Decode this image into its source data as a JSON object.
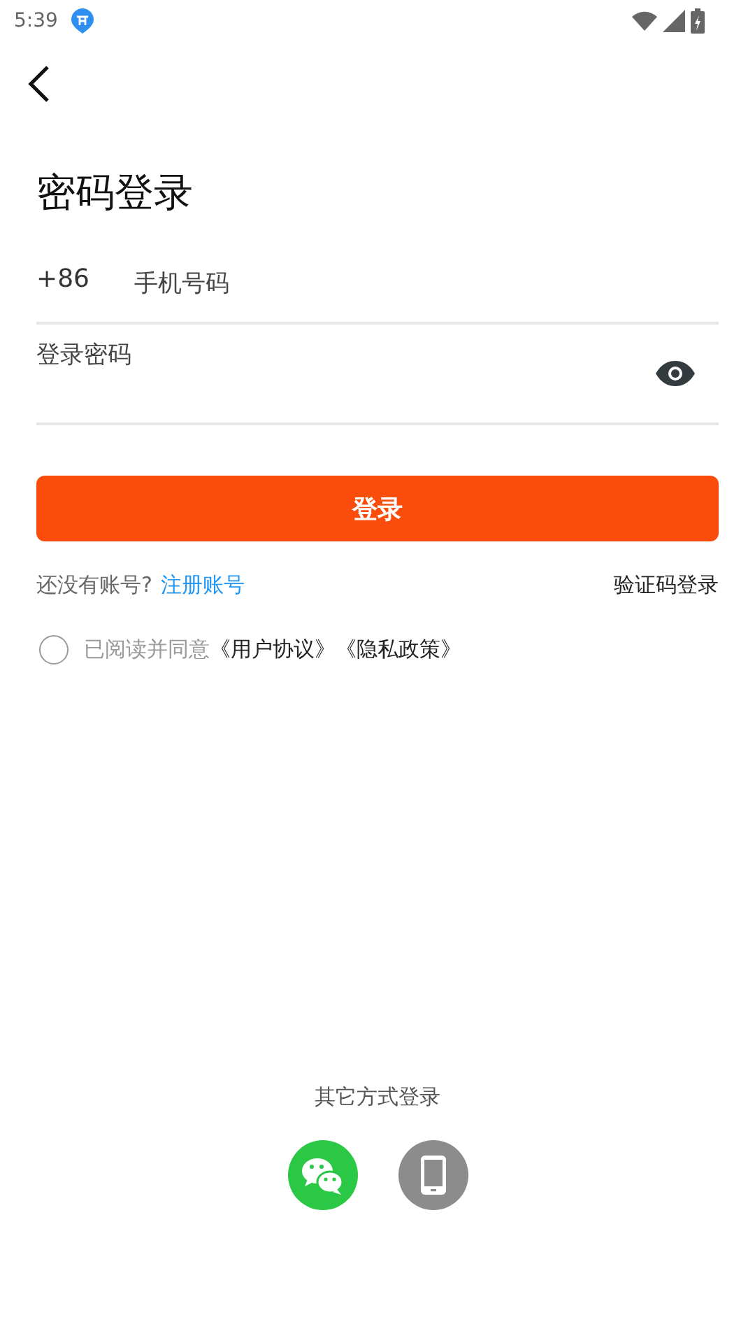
{
  "status_bar": {
    "time": "5:39"
  },
  "title": "密码登录",
  "phone": {
    "prefix": "+86",
    "placeholder": "手机号码"
  },
  "password": {
    "placeholder": "登录密码"
  },
  "login_button": "登录",
  "register": {
    "prompt": "还没有账号?",
    "link": "注册账号"
  },
  "code_login": "验证码登录",
  "agreement": {
    "checked": false,
    "text": "已阅读并同意",
    "links": [
      "《用户协议》",
      "《隐私政策》"
    ]
  },
  "other_methods": {
    "label": "其它方式登录",
    "options": [
      {
        "kind": "wechat"
      },
      {
        "kind": "phone"
      }
    ]
  }
}
